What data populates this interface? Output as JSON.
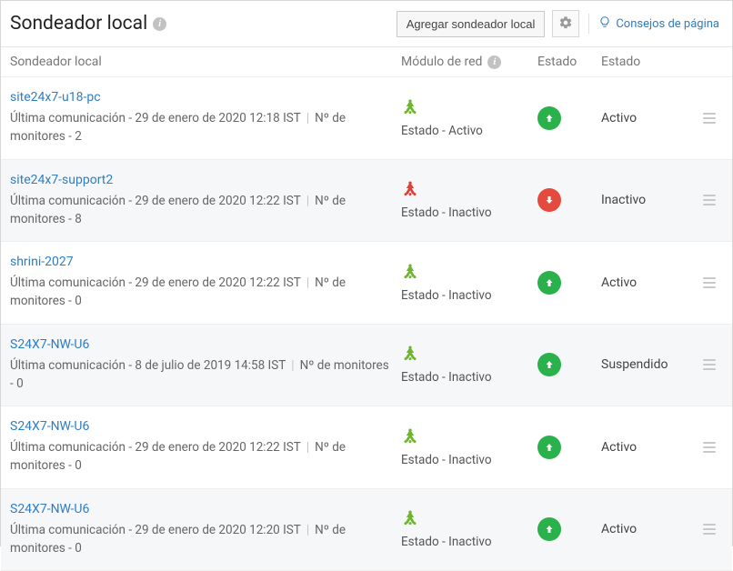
{
  "header": {
    "title": "Sondeador local",
    "add_button": "Agregar sondeador local",
    "tips_link": "Consejos de página"
  },
  "columns": {
    "name": "Sondeador local",
    "net": "Módulo de red",
    "status": "Estado",
    "state": "Estado"
  },
  "labels": {
    "last_comm_prefix": "Última comunicación - ",
    "monitors_prefix": "Nº de monitores - ",
    "net_state_prefix": "Estado - ",
    "net_active": "Activo",
    "net_inactive": "Inactivo"
  },
  "rows": [
    {
      "name": "site24x7-u18-pc",
      "last_comm": "29 de enero de 2020 12:18 IST",
      "monitors": "2",
      "net_active": true,
      "net_state_text": "Activo",
      "status_up": true,
      "state": "Activo"
    },
    {
      "name": "site24x7-support2",
      "last_comm": "29 de enero de 2020 12:22 IST",
      "monitors": "8",
      "net_active": false,
      "net_state_text": "Inactivo",
      "status_up": false,
      "state": "Inactivo"
    },
    {
      "name": "shrini-2027",
      "last_comm": "29 de enero de 2020 12:22 IST",
      "monitors": "0",
      "net_active": true,
      "net_state_text": "Inactivo",
      "status_up": true,
      "state": "Activo"
    },
    {
      "name": "S24X7-NW-U6",
      "last_comm": "8 de julio de 2019 14:58 IST",
      "monitors": "0",
      "net_active": true,
      "net_state_text": "Inactivo",
      "status_up": true,
      "state": "Suspendido"
    },
    {
      "name": "S24X7-NW-U6",
      "last_comm": "29 de enero de 2020 12:22 IST",
      "monitors": "0",
      "net_active": true,
      "net_state_text": "Inactivo",
      "status_up": true,
      "state": "Activo"
    },
    {
      "name": "S24X7-NW-U6",
      "last_comm": "29 de enero de 2020 12:20 IST",
      "monitors": "0",
      "net_active": true,
      "net_state_text": "Inactivo",
      "status_up": true,
      "state": "Activo"
    }
  ]
}
